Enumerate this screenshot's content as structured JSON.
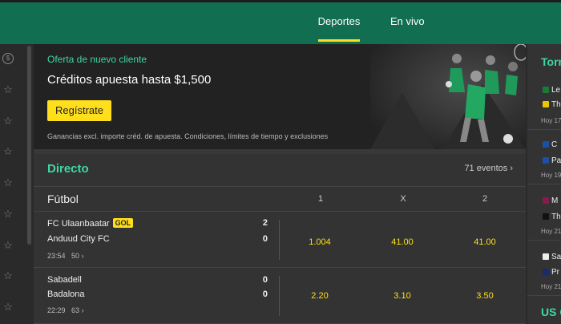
{
  "header": {
    "tabs": [
      {
        "label": "Deportes",
        "active": true
      },
      {
        "label": "En vivo",
        "active": false
      }
    ],
    "accent": "#ffdf1b",
    "bg": "#126e51"
  },
  "leftrail": {
    "icons": [
      "coin-icon",
      "star-icon",
      "star-icon",
      "star-icon",
      "star-icon",
      "star-icon",
      "star-icon",
      "star-icon",
      "star-icon",
      "star-icon"
    ]
  },
  "promo": {
    "kicker": "Oferta de nuevo cliente",
    "title": "Créditos apuesta hasta $1,500",
    "button": "Regístrate",
    "terms": "Ganancias excl. importe créd. de apuesta. Condiciones, límites de tiempo y exclusiones"
  },
  "live": {
    "title": "Directo",
    "count": "71 eventos",
    "sport": "Fútbol",
    "columns": [
      "1",
      "X",
      "2"
    ],
    "events": [
      {
        "home": "FC Ulaanbaatar",
        "away": "Anduud City FC",
        "home_score": "2",
        "away_score": "0",
        "badge": "GOL",
        "time": "23:54",
        "markets": "50",
        "odds": [
          "1.004",
          "41.00",
          "41.00"
        ]
      },
      {
        "home": "Sabadell",
        "away": "Badalona",
        "home_score": "0",
        "away_score": "0",
        "badge": "",
        "time": "22:29",
        "markets": "63",
        "odds": [
          "2.20",
          "3.10",
          "3.50"
        ]
      }
    ]
  },
  "right": {
    "title": "Torn",
    "title2": "US C",
    "matches": [
      {
        "home": "Le",
        "away": "Th",
        "time": "Hoy 17",
        "home_color": "#1a7a3a",
        "away_color": "#e8c800"
      },
      {
        "home": "C",
        "away": "Pa",
        "time": "Hoy 19",
        "home_color": "#1c4fa8",
        "away_color": "#1c4fa8"
      },
      {
        "home": "M",
        "away": "Th",
        "time": "Hoy 21",
        "home_color": "#8a1a4a",
        "away_color": "#111111"
      },
      {
        "home": "Sa",
        "away": "Pr",
        "time": "Hoy 21",
        "home_color": "#eeeeee",
        "away_color": "#1a2a6a"
      }
    ]
  }
}
